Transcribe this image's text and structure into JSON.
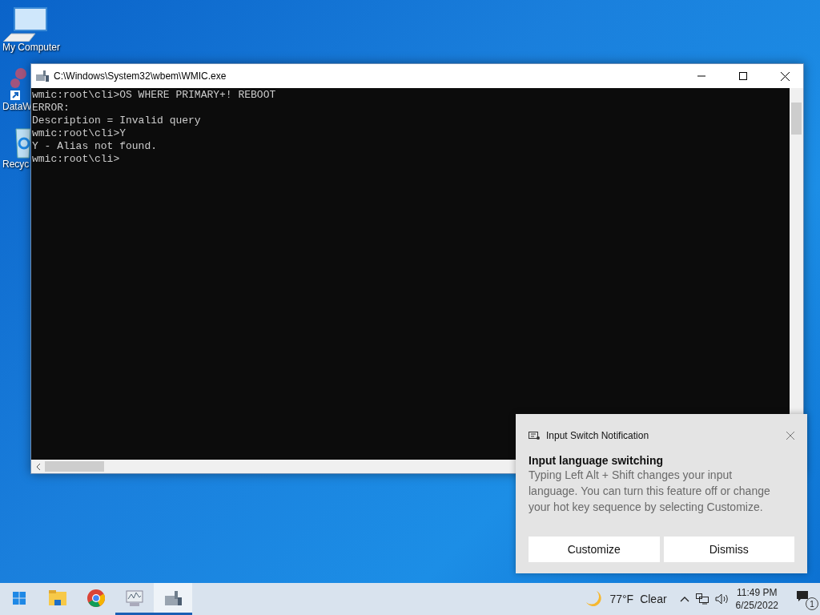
{
  "desktop_icons": [
    {
      "label": "My Computer",
      "kind": "computer"
    },
    {
      "label": "DataW",
      "kind": "shortcut"
    },
    {
      "label": "Recyc",
      "kind": "bin"
    }
  ],
  "window": {
    "title": "C:\\Windows\\System32\\wbem\\WMIC.exe",
    "console_lines": [
      "wmic:root\\cli>OS WHERE PRIMARY+! REBOOT",
      "ERROR:",
      "Description = Invalid query",
      "wmic:root\\cli>Y",
      "Y - Alias not found.",
      "wmic:root\\cli>"
    ]
  },
  "notification": {
    "app": "Input Switch Notification",
    "heading": "Input language switching",
    "body": "Typing Left Alt + Shift changes your input language. You can turn this feature off or change your hot key sequence by selecting Customize.",
    "buttons": [
      "Customize",
      "Dismiss"
    ]
  },
  "taskbar": {
    "apps": [
      {
        "kind": "explorer",
        "running": false,
        "selected": false
      },
      {
        "kind": "chrome",
        "running": false,
        "selected": false
      },
      {
        "kind": "monitor",
        "running": true,
        "selected": false
      },
      {
        "kind": "wmic",
        "running": true,
        "selected": true
      }
    ],
    "weather": {
      "temperature": "77°F",
      "condition": "Clear"
    },
    "time": "11:49 PM",
    "date": "6/25/2022",
    "notification_count": "1"
  }
}
